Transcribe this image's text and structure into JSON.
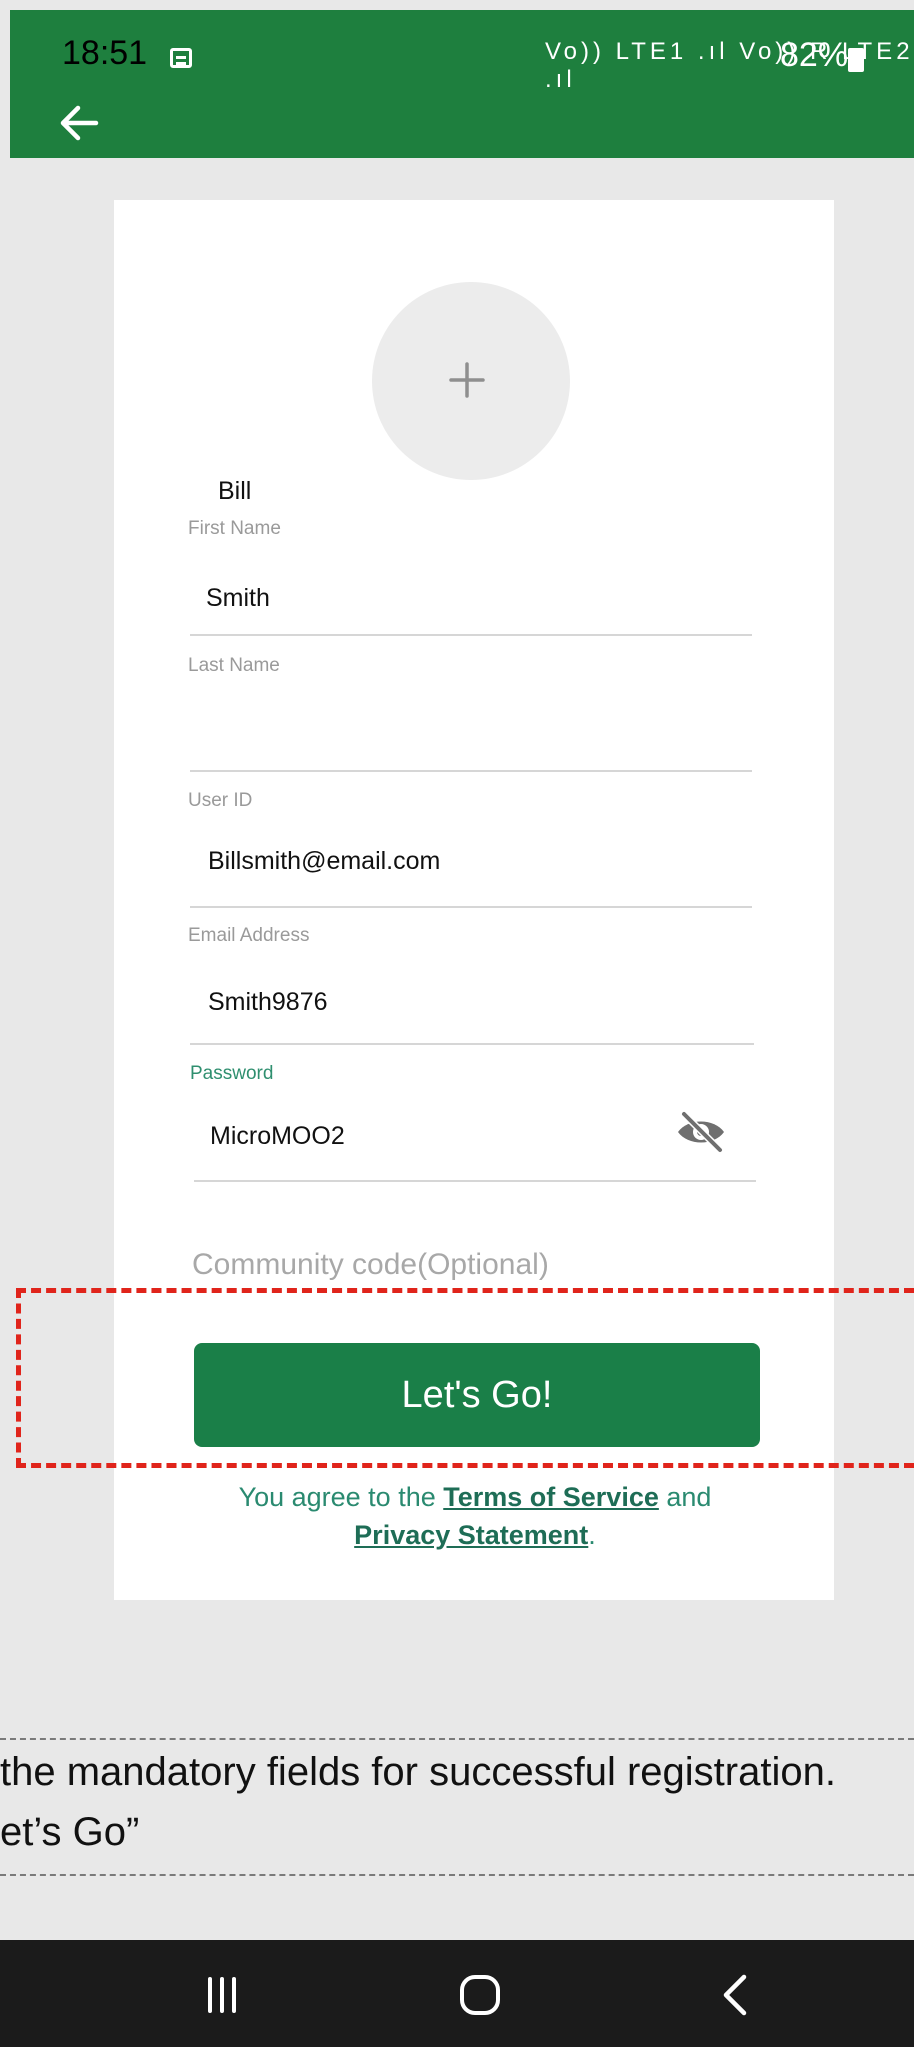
{
  "status_bar": {
    "time": "18:51",
    "network_text": "Vo)) LTE1 .ıl Vo)) R LTE2 .ıl",
    "battery": "82%"
  },
  "icons": {
    "back": "back-arrow-icon",
    "avatar_add": "plus-icon",
    "password_visibility": "eye-off-icon"
  },
  "form": {
    "first_name": {
      "value": "Bill",
      "label": "First Name"
    },
    "last_name": {
      "value": "Smith",
      "label": "Last Name"
    },
    "user_id": {
      "value": "",
      "label": "User ID"
    },
    "email": {
      "value": "Billsmith@email.com",
      "label": "Email Address"
    },
    "username": {
      "value": "Smith9876",
      "label": "Password"
    },
    "password": {
      "value": "MicroMOO2"
    },
    "community_placeholder": "Community code(Optional)",
    "submit_label": "Let's Go!",
    "agree": {
      "prefix": "You agree to the ",
      "terms": "Terms of Service",
      "middle": " and ",
      "privacy": "Privacy Statement",
      "suffix": "."
    }
  },
  "note": {
    "line1": "the mandatory fields for successful registration.",
    "line2": "et’s Go”"
  },
  "colors": {
    "brand_green": "#1e7f3e",
    "button_green": "#1a7f48",
    "highlight_red": "#e0241b",
    "link_teal": "#2a8a70"
  }
}
